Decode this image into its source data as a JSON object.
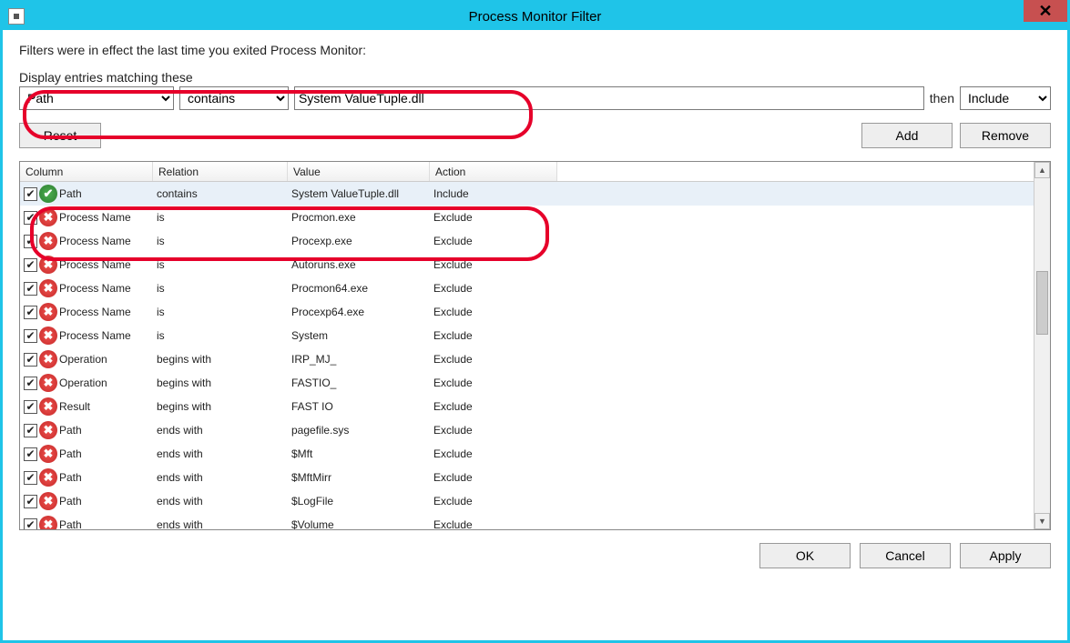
{
  "window": {
    "title": "Process Monitor Filter"
  },
  "info": "Filters were in effect the last time you exited Process Monitor:",
  "heading": "Display entries matching these",
  "filter": {
    "column_value": "Path",
    "relation_value": "contains",
    "text_value": "System ValueTuple.dll",
    "then_label": "then",
    "action_value": "Include"
  },
  "buttons": {
    "reset": "Reset",
    "add": "Add",
    "remove": "Remove",
    "ok": "OK",
    "cancel": "Cancel",
    "apply": "Apply"
  },
  "table": {
    "headers": {
      "column": "Column",
      "relation": "Relation",
      "value": "Value",
      "action": "Action"
    },
    "rows": [
      {
        "checked": true,
        "include": true,
        "column": "Path",
        "relation": "contains",
        "value": "System ValueTuple.dll",
        "action": "Include",
        "selected": true
      },
      {
        "checked": true,
        "include": false,
        "column": "Process Name",
        "relation": "is",
        "value": "Procmon.exe",
        "action": "Exclude"
      },
      {
        "checked": true,
        "include": false,
        "column": "Process Name",
        "relation": "is",
        "value": "Procexp.exe",
        "action": "Exclude"
      },
      {
        "checked": true,
        "include": false,
        "column": "Process Name",
        "relation": "is",
        "value": "Autoruns.exe",
        "action": "Exclude"
      },
      {
        "checked": true,
        "include": false,
        "column": "Process Name",
        "relation": "is",
        "value": "Procmon64.exe",
        "action": "Exclude"
      },
      {
        "checked": true,
        "include": false,
        "column": "Process Name",
        "relation": "is",
        "value": "Procexp64.exe",
        "action": "Exclude"
      },
      {
        "checked": true,
        "include": false,
        "column": "Process Name",
        "relation": "is",
        "value": "System",
        "action": "Exclude"
      },
      {
        "checked": true,
        "include": false,
        "column": "Operation",
        "relation": "begins with",
        "value": "IRP_MJ_",
        "action": "Exclude"
      },
      {
        "checked": true,
        "include": false,
        "column": "Operation",
        "relation": "begins with",
        "value": "FASTIO_",
        "action": "Exclude"
      },
      {
        "checked": true,
        "include": false,
        "column": "Result",
        "relation": "begins with",
        "value": "FAST IO",
        "action": "Exclude"
      },
      {
        "checked": true,
        "include": false,
        "column": "Path",
        "relation": "ends with",
        "value": "pagefile.sys",
        "action": "Exclude"
      },
      {
        "checked": true,
        "include": false,
        "column": "Path",
        "relation": "ends with",
        "value": "$Mft",
        "action": "Exclude"
      },
      {
        "checked": true,
        "include": false,
        "column": "Path",
        "relation": "ends with",
        "value": "$MftMirr",
        "action": "Exclude"
      },
      {
        "checked": true,
        "include": false,
        "column": "Path",
        "relation": "ends with",
        "value": "$LogFile",
        "action": "Exclude"
      },
      {
        "checked": true,
        "include": false,
        "column": "Path",
        "relation": "ends with",
        "value": "$Volume",
        "action": "Exclude"
      }
    ]
  }
}
